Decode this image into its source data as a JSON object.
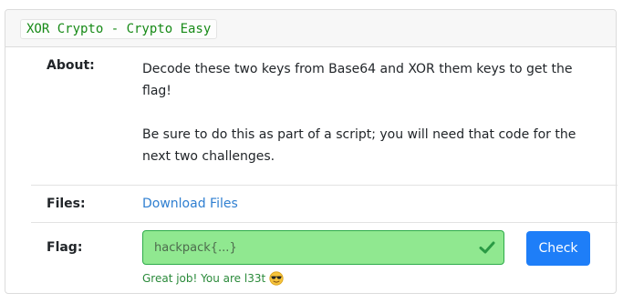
{
  "challenge": {
    "title": "XOR Crypto - Crypto Easy"
  },
  "about": {
    "label": "About:",
    "paragraph1": "Decode these two keys from Base64 and XOR them keys to get the flag!",
    "paragraph2": "Be sure to do this as part of a script; you will need that code for the next two challenges."
  },
  "files": {
    "label": "Files:",
    "link_text": "Download Files"
  },
  "flag": {
    "label": "Flag:",
    "input_value": "hackpack{...}",
    "check_label": "Check",
    "feedback": "Great job! You are l33t",
    "feedback_icon": "sunglasses-emoji-icon"
  },
  "colors": {
    "title_green": "#178a17",
    "input_success_bg": "#90e890",
    "success_border": "#2eab4a",
    "button_blue": "#1e7ef8",
    "link_blue": "#2f7fd1"
  }
}
